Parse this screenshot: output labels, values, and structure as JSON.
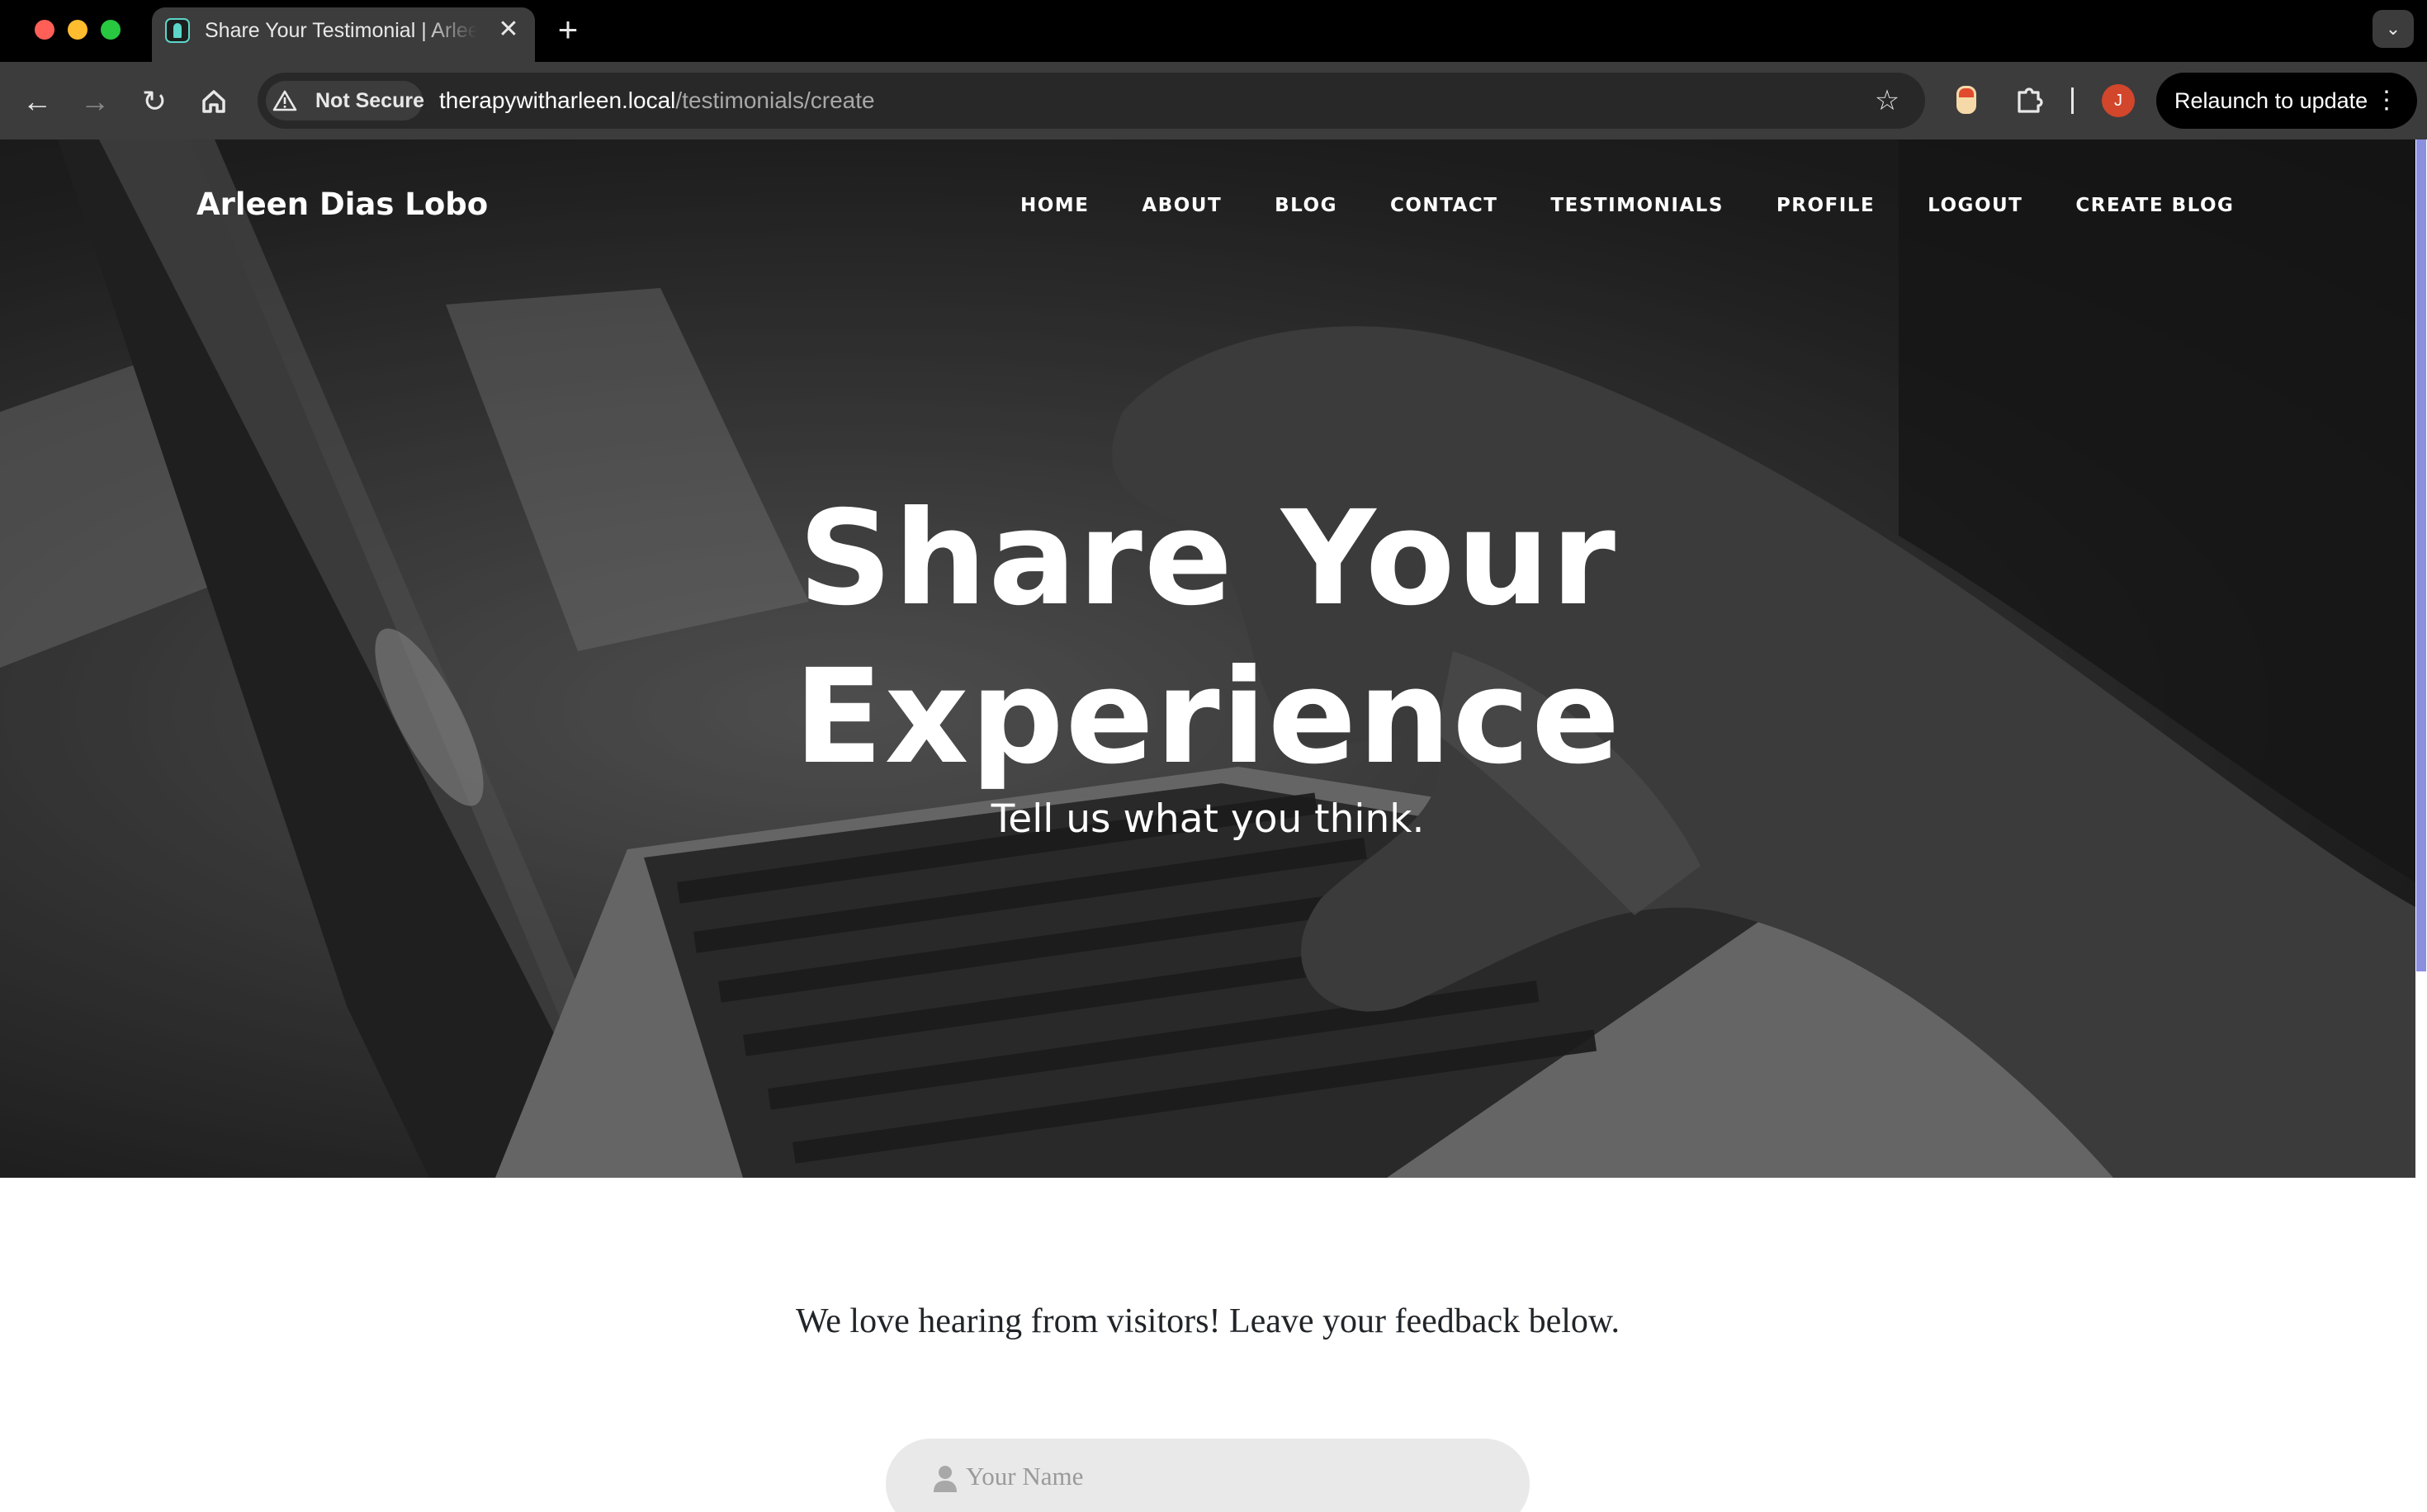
{
  "browser": {
    "tab_title": "Share Your Testimonial | Arleen Dias Lobo",
    "security_label": "Not Secure",
    "url_host": "therapywitharleen.local",
    "url_path": "/testimonials/create",
    "profile_initial": "J",
    "relaunch_label": "Relaunch to update"
  },
  "site": {
    "brand": "Arleen Dias Lobo",
    "nav": [
      "HOME",
      "ABOUT",
      "BLOG",
      "CONTACT",
      "TESTIMONIALS",
      "PROFILE",
      "LOGOUT",
      "CREATE BLOG"
    ]
  },
  "hero": {
    "title_line1": "Share Your",
    "title_line2": "Experience",
    "subtitle": "Tell us what you think."
  },
  "form": {
    "intro": "We love hearing from visitors! Leave your feedback below.",
    "name_placeholder": "Your Name",
    "name_icon": "user-icon"
  },
  "colors": {
    "scrollbar_thumb": "#8b8fe0",
    "avatar": "#d2462c"
  }
}
